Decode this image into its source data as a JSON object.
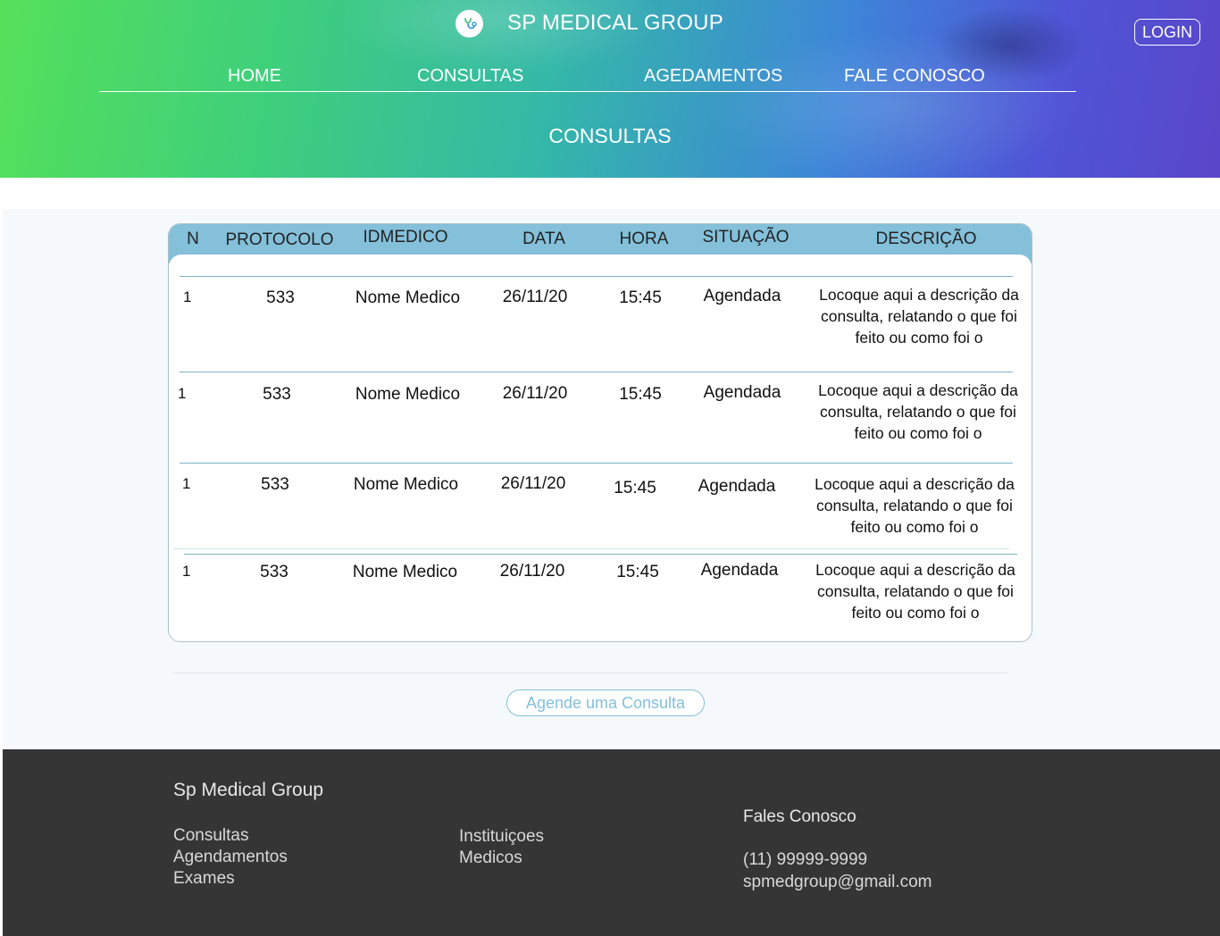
{
  "header": {
    "brand": "SP MEDICAL GROUP",
    "login": "LOGIN",
    "nav": [
      "HOME",
      "CONSULTAS",
      "AGEDAMENTOS",
      "FALE CONOSCO"
    ],
    "section_title": "CONSULTAS"
  },
  "table": {
    "columns": [
      "N",
      "PROTOCOLO",
      "IDMEDICO",
      "DATA",
      "HORA",
      "SITUAÇÃO",
      "DESCRIÇÃO"
    ],
    "rows": [
      {
        "n": "1",
        "protocolo": "533",
        "medico": "Nome Medico",
        "data": "26/11/20",
        "hora": "15:45",
        "situacao": "Agendada",
        "descricao": "Locoque aqui a descrição da consulta, relatando o que foi feito ou como foi o"
      },
      {
        "n": "1",
        "protocolo": "533",
        "medico": "Nome Medico",
        "data": "26/11/20",
        "hora": "15:45",
        "situacao": "Agendada",
        "descricao": "Locoque aqui a descrição da consulta, relatando o que foi feito ou como foi o"
      },
      {
        "n": "1",
        "protocolo": "533",
        "medico": "Nome Medico",
        "data": "26/11/20",
        "hora": "15:45",
        "situacao": "Agendada",
        "descricao": "Locoque aqui a descrição da consulta, relatando o que foi feito ou como foi o"
      },
      {
        "n": "1",
        "protocolo": "533",
        "medico": "Nome Medico",
        "data": "26/11/20",
        "hora": "15:45",
        "situacao": "Agendada",
        "descricao": "Locoque aqui a descrição da consulta, relatando o que foi feito ou como foi o"
      }
    ]
  },
  "cta": "Agende uma Consulta",
  "footer": {
    "title": "Sp Medical Group",
    "col1": [
      "Consultas",
      "Agendamentos",
      "Exames"
    ],
    "col2": [
      "Instituiçoes",
      "Medicos"
    ],
    "contact_title": "Fales Conosco",
    "phone": "(11) 99999-9999",
    "email": "spmedgroup@gmail.com"
  },
  "colors": {
    "table_header": "#84c0da",
    "footer_bg": "#353535"
  }
}
